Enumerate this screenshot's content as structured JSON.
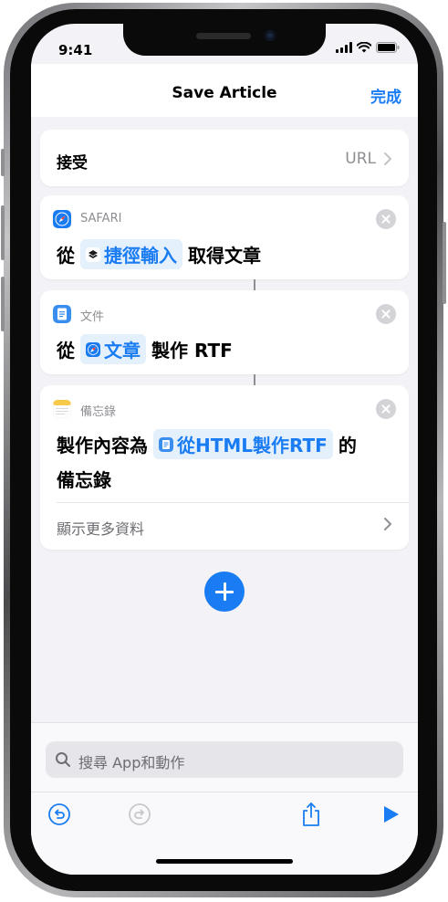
{
  "status_bar": {
    "time": "9:41"
  },
  "nav": {
    "title": "Save Article",
    "done": "完成"
  },
  "receive_card": {
    "label": "接受",
    "value": "URL"
  },
  "actions": [
    {
      "app": "SAFARI",
      "prefix": "從",
      "token": "捷徑輸入",
      "suffix": "取得文章"
    },
    {
      "app": "文件",
      "prefix": "從",
      "token": "文章",
      "suffix": "製作 RTF"
    },
    {
      "app": "備忘錄",
      "prefix": "製作內容為",
      "token": "從HTML製作RTF",
      "suffix": "的",
      "line2": "備忘錄",
      "more": "顯示更多資料"
    }
  ],
  "search": {
    "placeholder": "搜尋 App和動作"
  },
  "colors": {
    "accent": "#1a7cf2",
    "background": "#f2f2f7",
    "token_bg": "#e5f0fd"
  },
  "icons": [
    "signal-icon",
    "wifi-icon",
    "battery-icon",
    "chevron-right-icon",
    "safari-icon",
    "shortcuts-icon",
    "files-icon",
    "notes-icon",
    "close-icon",
    "plus-icon",
    "search-icon",
    "undo-icon",
    "redo-icon",
    "share-icon",
    "play-icon"
  ]
}
